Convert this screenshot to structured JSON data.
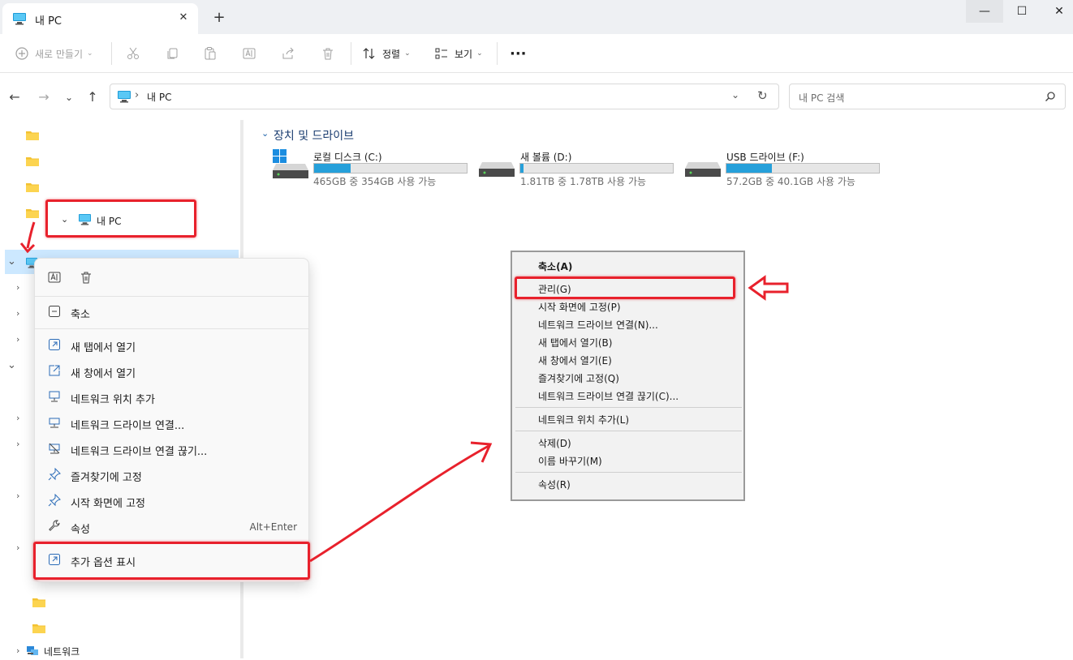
{
  "window": {
    "tab_title": "내 PC",
    "new_tab": "+",
    "tab_close": "✕",
    "minimize": "—",
    "maximize": "☐",
    "close": "✕"
  },
  "toolbar": {
    "new_label": "새로 만들기",
    "sort_label": "정렬",
    "view_label": "보기",
    "more_label": "···"
  },
  "address": {
    "path": "내 PC",
    "search_placeholder": "내 PC 검색"
  },
  "navpane": {
    "this_pc_label": "내 PC",
    "network_label": "네트워크"
  },
  "content": {
    "section_title": "장치 및 드라이브",
    "drives": [
      {
        "name": "로컬 디스크 (C:)",
        "free_text": "465GB 중 354GB 사용 가능",
        "used_fraction": 0.24
      },
      {
        "name": "새 볼륨 (D:)",
        "free_text": "1.81TB 중 1.78TB 사용 가능",
        "used_fraction": 0.02
      },
      {
        "name": "USB 드라이브 (F:)",
        "free_text": "57.2GB 중 40.1GB 사용 가능",
        "used_fraction": 0.3
      }
    ]
  },
  "context_menu": {
    "items": [
      {
        "label": "축소"
      },
      {
        "label": "새 탭에서 열기"
      },
      {
        "label": "새 창에서 열기"
      },
      {
        "label": "네트워크 위치 추가"
      },
      {
        "label": "네트워크 드라이브 연결..."
      },
      {
        "label": "네트워크 드라이브 연결 끊기..."
      },
      {
        "label": "즐겨찾기에 고정"
      },
      {
        "label": "시작 화면에 고정"
      },
      {
        "label": "속성",
        "shortcut": "Alt+Enter"
      },
      {
        "label": "추가 옵션 표시"
      }
    ]
  },
  "classic_menu": {
    "items": [
      "축소(A)",
      "관리(G)",
      "시작 화면에 고정(P)",
      "네트워크 드라이브 연결(N)...",
      "새 탭에서 열기(B)",
      "새 창에서 열기(E)",
      "즐겨찾기에 고정(Q)",
      "네트워크 드라이브 연결 끊기(C)...",
      "네트워크 위치 추가(L)",
      "삭제(D)",
      "이름 바꾸기(M)",
      "속성(R)"
    ]
  },
  "colors": {
    "accent": "#26a0da",
    "selection": "#cce8ff",
    "annotation": "#e8212c"
  }
}
